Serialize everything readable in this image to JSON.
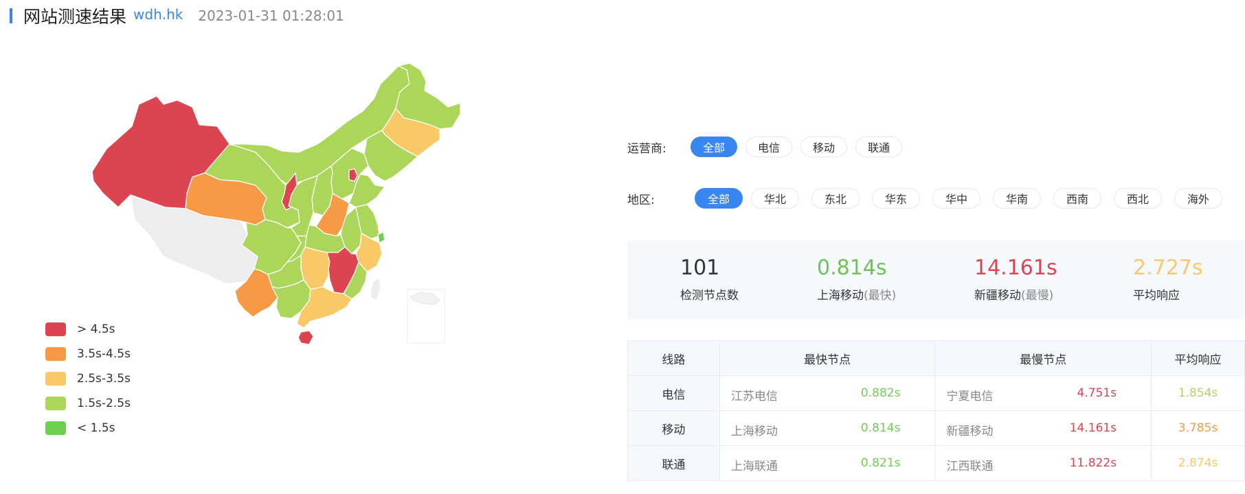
{
  "header": {
    "title": "网站测速结果",
    "domain": "wdh.hk",
    "timestamp": "2023-01-31 01:28:01"
  },
  "colors": {
    "accent": "#3a86f0",
    "red": "#dc4450",
    "orange": "#f89a45",
    "yellow": "#f9c968",
    "lightgreen": "#acd65a",
    "green": "#6fcf50",
    "nodata": "#ededed"
  },
  "legend": [
    {
      "label": "> 4.5s",
      "color": "#dc4450"
    },
    {
      "label": "3.5s-4.5s",
      "color": "#f89a45"
    },
    {
      "label": "2.5s-3.5s",
      "color": "#f9c968"
    },
    {
      "label": "1.5s-2.5s",
      "color": "#acd65a"
    },
    {
      "label": "< 1.5s",
      "color": "#6fcf50"
    }
  ],
  "filters": {
    "carrier": {
      "label": "运营商:",
      "options": [
        "全部",
        "电信",
        "移动",
        "联通"
      ],
      "selected": "全部"
    },
    "region": {
      "label": "地区:",
      "options": [
        "全部",
        "华北",
        "东北",
        "华东",
        "华中",
        "华南",
        "西南",
        "西北",
        "海外"
      ],
      "selected": "全部"
    }
  },
  "stats": [
    {
      "value": "101",
      "label": "检测节点数",
      "note": "",
      "color": "#333333"
    },
    {
      "value": "0.814s",
      "label": "上海移动",
      "note": "(最快)",
      "color": "#6ac553"
    },
    {
      "value": "14.161s",
      "label": "新疆移动",
      "note": "(最慢)",
      "color": "#dc4450"
    },
    {
      "value": "2.727s",
      "label": "平均响应",
      "note": "",
      "color": "#f9c968"
    }
  ],
  "table": {
    "headers": [
      "线路",
      "最快节点",
      "最慢节点",
      "平均响应"
    ],
    "rows": [
      {
        "line": "电信",
        "fast_node": "江苏电信",
        "fast_time": "0.882s",
        "slow_node": "宁夏电信",
        "slow_time": "4.751s",
        "avg": "1.854s",
        "avg_color": "#acd65a"
      },
      {
        "line": "移动",
        "fast_node": "上海移动",
        "fast_time": "0.814s",
        "slow_node": "新疆移动",
        "slow_time": "14.161s",
        "avg": "3.785s",
        "avg_color": "#f89a45"
      },
      {
        "line": "联通",
        "fast_node": "上海联通",
        "fast_time": "0.821s",
        "slow_node": "江西联通",
        "slow_time": "11.822s",
        "avg": "2.874s",
        "avg_color": "#f9c968"
      }
    ]
  },
  "map": {
    "regions": [
      {
        "name": "xinjiang",
        "color": "#dc4450"
      },
      {
        "name": "tibet",
        "color": "#ededed"
      },
      {
        "name": "qinghai",
        "color": "#f89a45"
      },
      {
        "name": "gansu",
        "color": "#acd65a"
      },
      {
        "name": "inner-mongolia",
        "color": "#acd65a"
      },
      {
        "name": "heilongjiang",
        "color": "#acd65a"
      },
      {
        "name": "jilin",
        "color": "#f9c968"
      },
      {
        "name": "liaoning",
        "color": "#acd65a"
      },
      {
        "name": "hebei",
        "color": "#acd65a"
      },
      {
        "name": "beijing",
        "color": "#dc4450"
      },
      {
        "name": "shandong",
        "color": "#acd65a"
      },
      {
        "name": "shanxi",
        "color": "#acd65a"
      },
      {
        "name": "ningxia",
        "color": "#dc4450"
      },
      {
        "name": "shaanxi",
        "color": "#acd65a"
      },
      {
        "name": "henan",
        "color": "#f89a45"
      },
      {
        "name": "jiangsu",
        "color": "#acd65a"
      },
      {
        "name": "anhui",
        "color": "#acd65a"
      },
      {
        "name": "shanghai",
        "color": "#6fcf50"
      },
      {
        "name": "zhejiang",
        "color": "#f9c968"
      },
      {
        "name": "hubei",
        "color": "#acd65a"
      },
      {
        "name": "sichuan",
        "color": "#acd65a"
      },
      {
        "name": "chongqing",
        "color": "#acd65a"
      },
      {
        "name": "hunan",
        "color": "#f9c968"
      },
      {
        "name": "jiangxi",
        "color": "#dc4450"
      },
      {
        "name": "fujian",
        "color": "#acd65a"
      },
      {
        "name": "yunnan",
        "color": "#f89a45"
      },
      {
        "name": "guizhou",
        "color": "#acd65a"
      },
      {
        "name": "guangxi",
        "color": "#acd65a"
      },
      {
        "name": "guangdong",
        "color": "#f9c968"
      },
      {
        "name": "hainan",
        "color": "#dc4450"
      },
      {
        "name": "taiwan",
        "color": "#ededed"
      }
    ]
  }
}
